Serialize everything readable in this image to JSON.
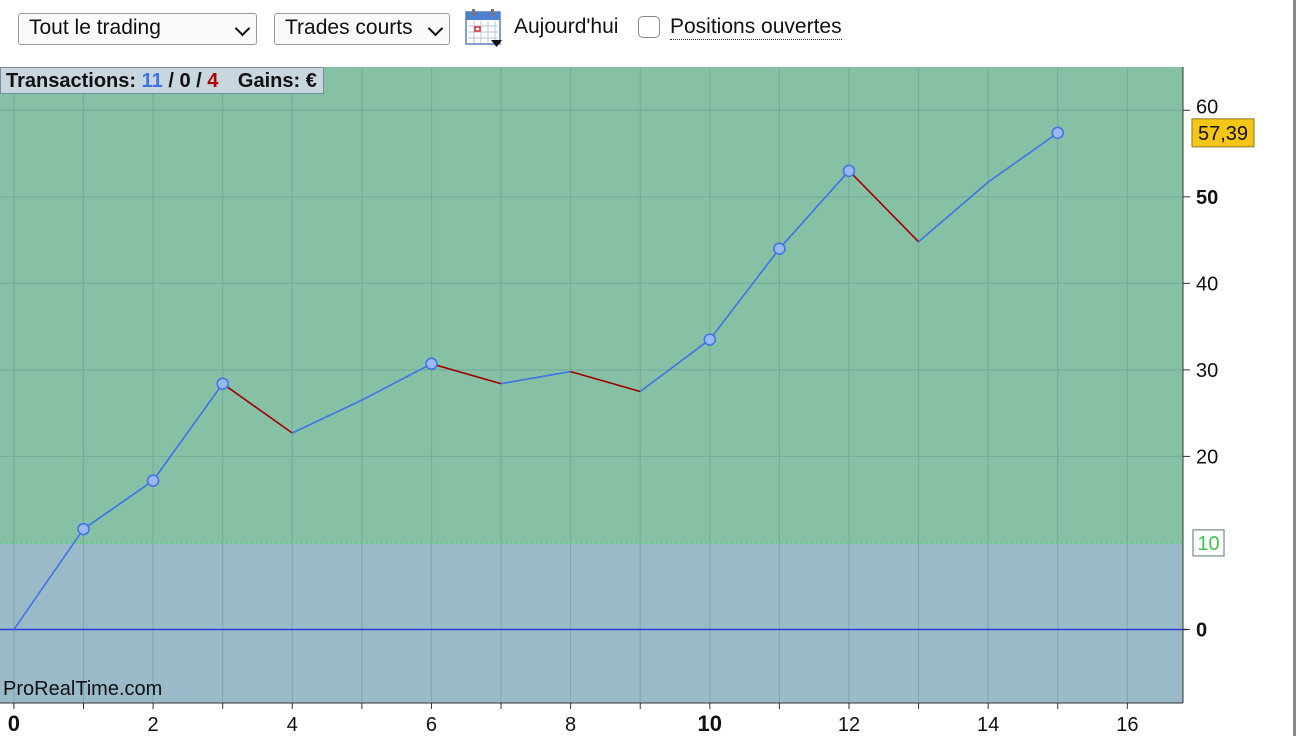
{
  "toolbar": {
    "trading_select": "Tout le trading",
    "trades_select": "Trades courts",
    "today_label": "Aujourd'hui",
    "open_positions_label": "Positions ouvertes",
    "open_positions_checked": false
  },
  "stats": {
    "transactions_label": "Transactions:",
    "wins": "11",
    "sep1": " / ",
    "neutral": "0",
    "sep2": " / ",
    "losses": "4",
    "gains_label": "Gains: €"
  },
  "watermark": "ProRealTime.com",
  "colors": {
    "above_band": "#86c1a6",
    "below_band": "#9bbac9",
    "rising_line": "#3f73e8",
    "falling_line": "#a00000",
    "zero_line": "#2a3fd6",
    "threshold_line": "#5ed07a",
    "last_value_badge": "#f5c518"
  },
  "chart_data": {
    "type": "line",
    "x": [
      0,
      1,
      2,
      3,
      4,
      5,
      6,
      7,
      8,
      9,
      10,
      11,
      12,
      13,
      14,
      15
    ],
    "y": [
      0,
      11.6,
      17.2,
      28.4,
      22.7,
      26.5,
      30.7,
      28.4,
      29.8,
      27.5,
      33.5,
      44.0,
      53.0,
      44.8,
      51.7,
      57.39
    ],
    "markers": [
      1,
      2,
      3,
      6,
      10,
      11,
      12,
      15
    ],
    "xlim": [
      -0.2,
      16.8
    ],
    "ylim": [
      -8.5,
      65
    ],
    "x_ticks": [
      {
        "value": 0,
        "label": "0",
        "bold": true
      },
      {
        "value": 2,
        "label": "2",
        "bold": false
      },
      {
        "value": 4,
        "label": "4",
        "bold": false
      },
      {
        "value": 6,
        "label": "6",
        "bold": false
      },
      {
        "value": 8,
        "label": "8",
        "bold": false
      },
      {
        "value": 10,
        "label": "10",
        "bold": true
      },
      {
        "value": 12,
        "label": "12",
        "bold": false
      },
      {
        "value": 14,
        "label": "14",
        "bold": false
      },
      {
        "value": 16,
        "label": "16",
        "bold": false
      }
    ],
    "y_ticks": [
      {
        "value": 0,
        "label": "0",
        "bold": true
      },
      {
        "value": 20,
        "label": "20",
        "bold": false
      },
      {
        "value": 30,
        "label": "30",
        "bold": false
      },
      {
        "value": 40,
        "label": "40",
        "bold": false
      },
      {
        "value": 50,
        "label": "50",
        "bold": true
      },
      {
        "value": 60,
        "label": "60",
        "bold": false
      }
    ],
    "threshold": {
      "value": 10,
      "label": "10"
    },
    "last_value": {
      "value": 57.39,
      "label": "57,39"
    },
    "grid": true
  }
}
